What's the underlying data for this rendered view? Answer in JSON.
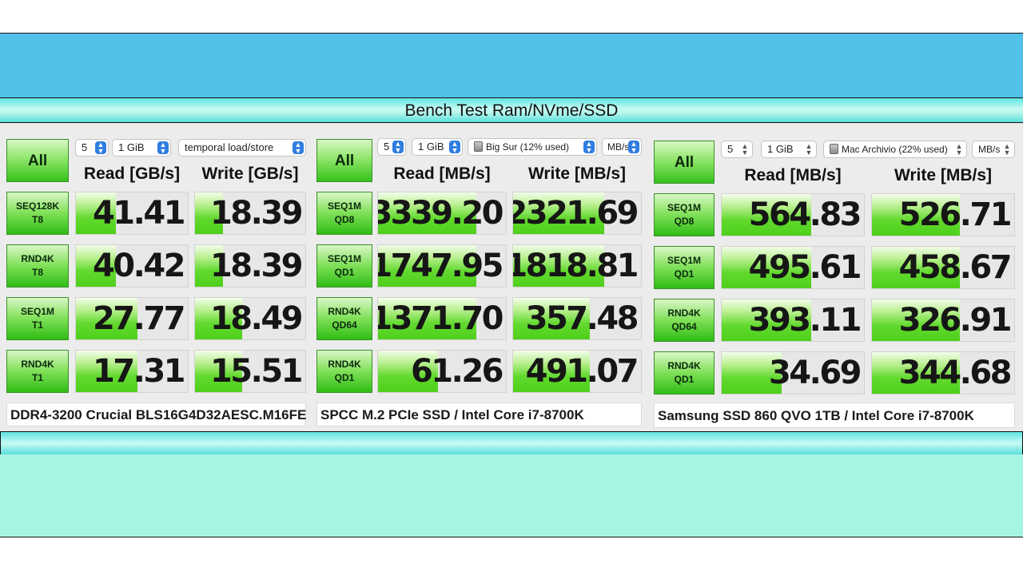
{
  "title": "Bench Test Ram/NVme/SSD",
  "panels": [
    {
      "controls": {
        "count": "5",
        "size": "1 GiB",
        "target": "temporal load/store",
        "unit": ""
      },
      "all_label": "All",
      "read_header": "Read [GB/s]",
      "write_header": "Write [GB/s]",
      "tests": [
        {
          "label1": "SEQ128K",
          "label2": "T8",
          "read": "41.41",
          "write": "18.39",
          "read_fill": 0.36,
          "write_fill": 0.25
        },
        {
          "label1": "RND4K",
          "label2": "T8",
          "read": "40.42",
          "write": "18.39",
          "read_fill": 0.36,
          "write_fill": 0.25
        },
        {
          "label1": "SEQ1M",
          "label2": "T1",
          "read": "27.77",
          "write": "18.49",
          "read_fill": 0.55,
          "write_fill": 0.43
        },
        {
          "label1": "RND4K",
          "label2": "T1",
          "read": "17.31",
          "write": "15.51",
          "read_fill": 0.55,
          "write_fill": 0.43
        }
      ],
      "note": "DDR4-3200 Crucial BLS16G4D32AESC.M16FE"
    },
    {
      "controls": {
        "count": "5",
        "size": "1 GiB",
        "target": "Big Sur (12% used)",
        "unit": "MB/s"
      },
      "all_label": "All",
      "read_header": "Read [MB/s]",
      "write_header": "Write [MB/s]",
      "tests": [
        {
          "label1": "SEQ1M",
          "label2": "QD8",
          "read": "3339.20",
          "write": "2321.69",
          "read_fill": 0.77,
          "write_fill": 0.71
        },
        {
          "label1": "SEQ1M",
          "label2": "QD1",
          "read": "1747.95",
          "write": "1818.81",
          "read_fill": 0.77,
          "write_fill": 0.71
        },
        {
          "label1": "RND4K",
          "label2": "QD64",
          "read": "1371.70",
          "write": "357.48",
          "read_fill": 0.77,
          "write_fill": 0.6
        },
        {
          "label1": "RND4K",
          "label2": "QD1",
          "read": "61.26",
          "write": "491.07",
          "read_fill": 0.47,
          "write_fill": 0.6
        }
      ],
      "note": "SPCC M.2 PCIe SSD / Intel Core i7-8700K"
    },
    {
      "controls": {
        "count": "5",
        "size": "1 GiB",
        "target": "Mac Archivio (22% used)",
        "unit": "MB/s"
      },
      "all_label": "All",
      "read_header": "Read [MB/s]",
      "write_header": "Write [MB/s]",
      "tests": [
        {
          "label1": "SEQ1M",
          "label2": "QD8",
          "read": "564.83",
          "write": "526.71",
          "read_fill": 0.63,
          "write_fill": 0.62
        },
        {
          "label1": "SEQ1M",
          "label2": "QD1",
          "read": "495.61",
          "write": "458.67",
          "read_fill": 0.63,
          "write_fill": 0.62
        },
        {
          "label1": "RND4K",
          "label2": "QD64",
          "read": "393.11",
          "write": "326.91",
          "read_fill": 0.63,
          "write_fill": 0.62
        },
        {
          "label1": "RND4K",
          "label2": "QD1",
          "read": "34.69",
          "write": "344.68",
          "read_fill": 0.42,
          "write_fill": 0.62
        }
      ],
      "note": "Samsung SSD 860 QVO 1TB / Intel Core i7-8700K"
    }
  ]
}
